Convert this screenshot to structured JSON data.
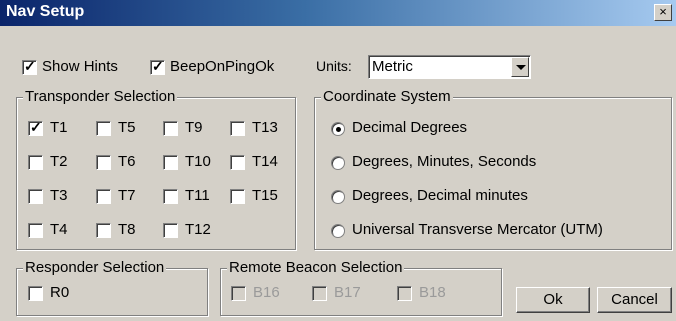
{
  "window": {
    "title": "Nav Setup",
    "close_label": "×"
  },
  "options": {
    "show_hints": {
      "label": "Show Hints",
      "checked": true
    },
    "beep_on_ping_ok": {
      "label": "BeepOnPingOk",
      "checked": true
    },
    "units_label": "Units:",
    "units_value": "Metric"
  },
  "transponder": {
    "title": "Transponder Selection",
    "items": [
      {
        "label": "T1",
        "checked": true
      },
      {
        "label": "T5",
        "checked": false
      },
      {
        "label": "T9",
        "checked": false
      },
      {
        "label": "T13",
        "checked": false
      },
      {
        "label": "T2",
        "checked": false
      },
      {
        "label": "T6",
        "checked": false
      },
      {
        "label": "T10",
        "checked": false
      },
      {
        "label": "T14",
        "checked": false
      },
      {
        "label": "T3",
        "checked": false
      },
      {
        "label": "T7",
        "checked": false
      },
      {
        "label": "T11",
        "checked": false
      },
      {
        "label": "T15",
        "checked": false
      },
      {
        "label": "T4",
        "checked": false
      },
      {
        "label": "T8",
        "checked": false
      },
      {
        "label": "T12",
        "checked": false
      }
    ]
  },
  "coordinate": {
    "title": "Coordinate System",
    "options": [
      {
        "label": "Decimal Degrees",
        "selected": true
      },
      {
        "label": "Degrees, Minutes, Seconds",
        "selected": false
      },
      {
        "label": "Degrees, Decimal minutes",
        "selected": false
      },
      {
        "label": "Universal Transverse Mercator (UTM)",
        "selected": false
      }
    ]
  },
  "responder": {
    "title": "Responder Selection",
    "items": [
      {
        "label": "R0",
        "checked": false
      }
    ]
  },
  "remote_beacon": {
    "title": "Remote Beacon Selection",
    "items": [
      {
        "label": "B16",
        "checked": false
      },
      {
        "label": "B17",
        "checked": false
      },
      {
        "label": "B18",
        "checked": false
      }
    ]
  },
  "buttons": {
    "ok": "Ok",
    "cancel": "Cancel"
  }
}
